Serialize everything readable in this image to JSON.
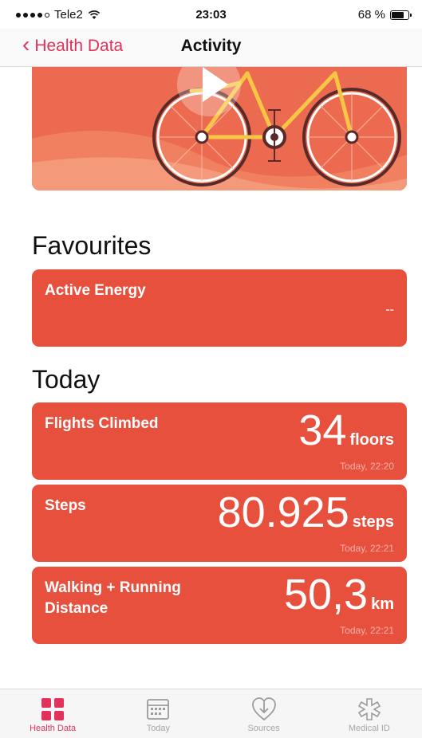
{
  "status_bar": {
    "carrier": "Tele2",
    "time": "23:03",
    "battery_percent": "68 %"
  },
  "nav": {
    "back_label": "Health Data",
    "title": "Activity"
  },
  "sections": {
    "favourites_title": "Favourites",
    "today_title": "Today"
  },
  "favourites": [
    {
      "label": "Active Energy",
      "value": "--"
    }
  ],
  "today": [
    {
      "label": "Flights Climbed",
      "value": "34",
      "unit": "floors",
      "time": "Today, 22:20"
    },
    {
      "label": "Steps",
      "value": "80.925",
      "unit": "steps",
      "time": "Today, 22:21"
    },
    {
      "label": "Walking + Running Distance",
      "value": "50,3",
      "unit": "km",
      "time": "Today, 22:21"
    }
  ],
  "tabs": [
    {
      "label": "Health Data",
      "icon": "grid-icon",
      "active": true
    },
    {
      "label": "Today",
      "icon": "calendar-icon",
      "active": false
    },
    {
      "label": "Sources",
      "icon": "download-heart-icon",
      "active": false
    },
    {
      "label": "Medical ID",
      "icon": "asterisk-icon",
      "active": false
    }
  ],
  "colors": {
    "accent": "#e0325a",
    "card": "#e8503e",
    "hero": "#ec6b50"
  }
}
